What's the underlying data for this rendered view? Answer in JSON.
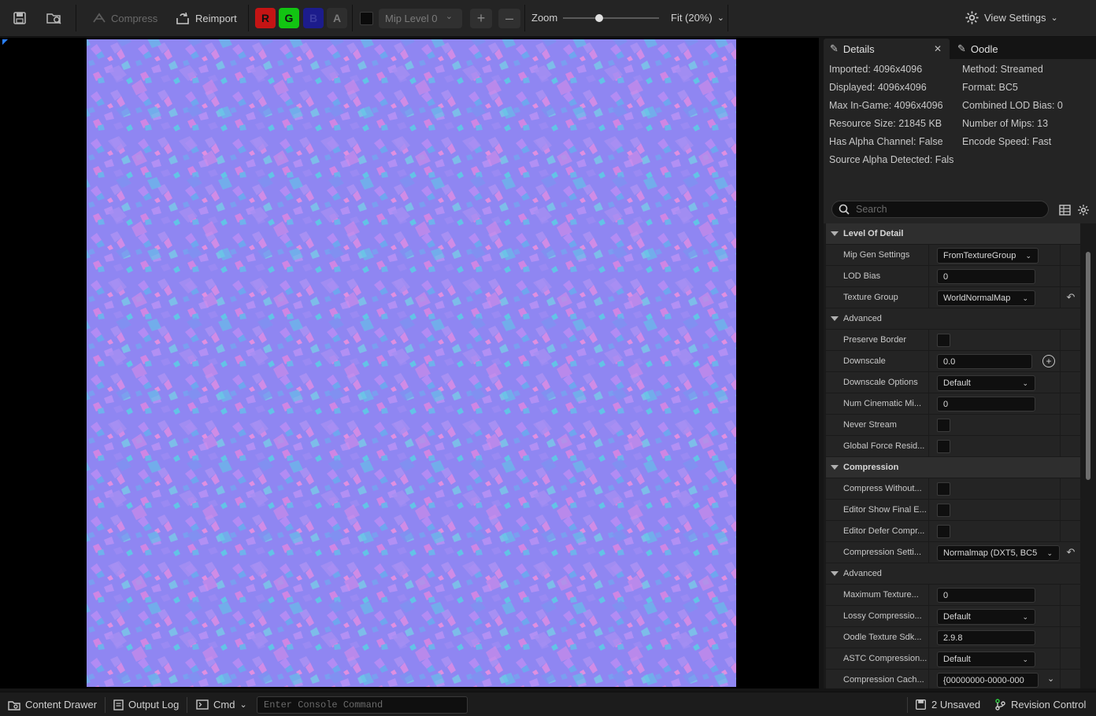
{
  "toolbar": {
    "compress_label": "Compress",
    "reimport_label": "Reimport",
    "channels": [
      {
        "letter": "R",
        "color": "#c41414",
        "text_color": "#111111"
      },
      {
        "letter": "G",
        "color": "#12c412",
        "text_color": "#111111"
      },
      {
        "letter": "B",
        "color": "#1c1c8c",
        "text_color": "#3a3aa0"
      },
      {
        "letter": "A",
        "color": "#2e2e2e",
        "text_color": "#7a7a7a"
      }
    ],
    "mip_level": "Mip Level 0",
    "zoom_label": "Zoom",
    "zoom_value": 0.36,
    "fit_label": "Fit (20%)",
    "view_settings_label": "View Settings"
  },
  "details": {
    "tabs": [
      {
        "label": "Details",
        "active": true
      },
      {
        "label": "Oodle",
        "active": false
      }
    ],
    "info_left": [
      "Imported: 4096x4096",
      "Displayed: 4096x4096",
      "Max In-Game: 4096x4096",
      "Resource Size: 21845 KB",
      "Has Alpha Channel: False",
      "Source Alpha Detected: Fals"
    ],
    "info_right": [
      "Method: Streamed",
      "Format: BC5",
      "Combined LOD Bias: 0",
      "Number of Mips: 13",
      "Encode Speed: Fast"
    ],
    "search_placeholder": "Search",
    "rows": [
      {
        "kind": "category",
        "label": "Level Of Detail"
      },
      {
        "kind": "dropdown",
        "label": "Mip Gen Settings",
        "value": "FromTextureGroup"
      },
      {
        "kind": "input",
        "label": "LOD Bias",
        "value": "0"
      },
      {
        "kind": "dropdown",
        "label": "Texture Group",
        "value": "WorldNormalMap",
        "reset": true
      },
      {
        "kind": "subcategory",
        "label": "Advanced"
      },
      {
        "kind": "checkbox",
        "label": "Preserve Border"
      },
      {
        "kind": "input",
        "label": "Downscale",
        "value": "0.0",
        "add": true
      },
      {
        "kind": "dropdown",
        "label": "Downscale Options",
        "value": "Default"
      },
      {
        "kind": "input",
        "label": "Num Cinematic Mi...",
        "value": "0"
      },
      {
        "kind": "checkbox",
        "label": "Never Stream"
      },
      {
        "kind": "checkbox",
        "label": "Global Force Resid..."
      },
      {
        "kind": "category",
        "label": "Compression"
      },
      {
        "kind": "checkbox",
        "label": "Compress Without..."
      },
      {
        "kind": "checkbox",
        "label": "Editor Show Final E..."
      },
      {
        "kind": "checkbox",
        "label": "Editor Defer Compr..."
      },
      {
        "kind": "dropdown",
        "label": "Compression Setti...",
        "value": "Normalmap (DXT5, BC5",
        "reset": true,
        "wide": true
      },
      {
        "kind": "subcategory",
        "label": "Advanced"
      },
      {
        "kind": "input",
        "label": "Maximum Texture...",
        "value": "0"
      },
      {
        "kind": "dropdown",
        "label": "Lossy Compressio...",
        "value": "Default"
      },
      {
        "kind": "input",
        "label": "Oodle Texture Sdk...",
        "value": "2.9.8"
      },
      {
        "kind": "dropdown",
        "label": "ASTC Compression...",
        "value": "Default"
      },
      {
        "kind": "input",
        "label": "Compression Cach...",
        "value": "{00000000-0000-000",
        "expand": true
      }
    ]
  },
  "statusbar": {
    "content_drawer": "Content Drawer",
    "output_log": "Output Log",
    "cmd": "Cmd",
    "console_placeholder": "Enter Console Command",
    "unsaved": "2 Unsaved",
    "revision_control": "Revision Control"
  }
}
